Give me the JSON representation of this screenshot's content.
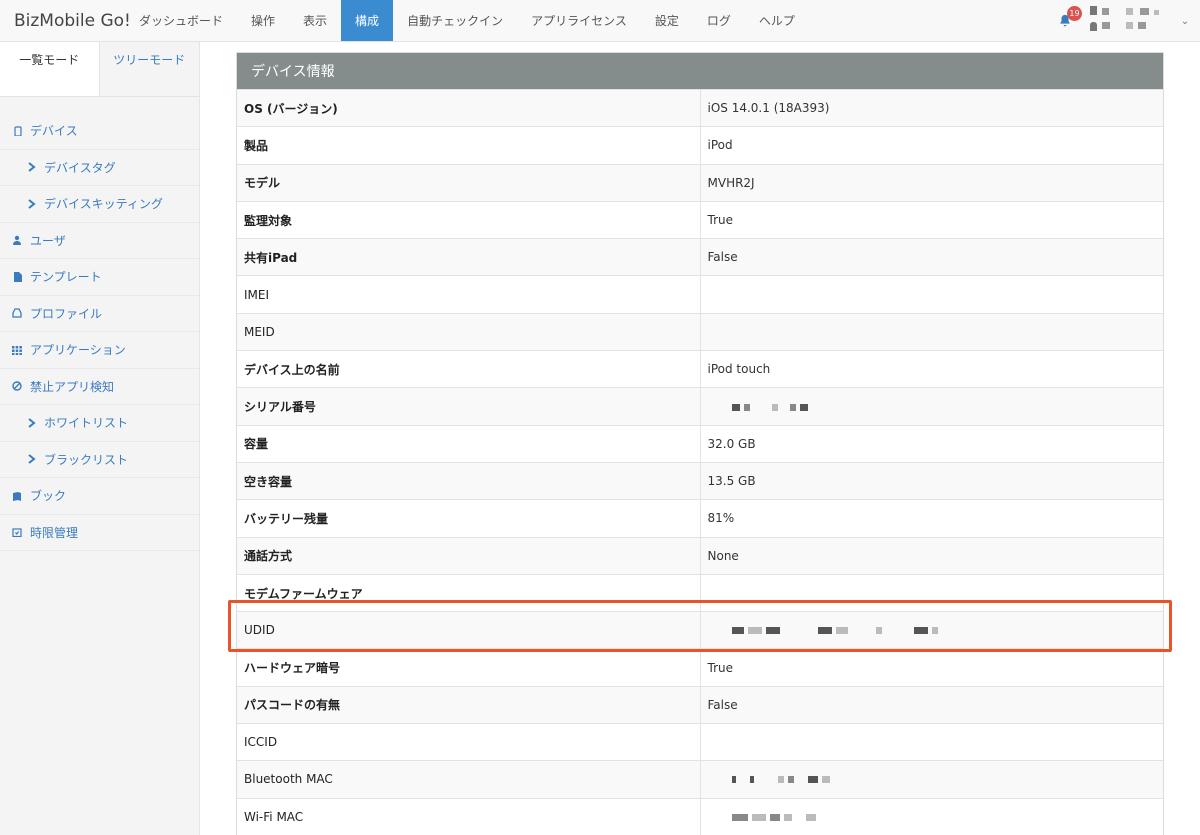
{
  "navbar": {
    "brand": "BizMobile Go!",
    "items": [
      {
        "label": "ダッシュボード",
        "active": false
      },
      {
        "label": "操作",
        "active": false
      },
      {
        "label": "表示",
        "active": false
      },
      {
        "label": "構成",
        "active": true
      },
      {
        "label": "自動チェックイン",
        "active": false
      },
      {
        "label": "アプリライセンス",
        "active": false
      },
      {
        "label": "設定",
        "active": false
      },
      {
        "label": "ログ",
        "active": false
      },
      {
        "label": "ヘルプ",
        "active": false
      }
    ],
    "notification_count": "19",
    "icons": {
      "bell": "bell-icon",
      "caret": "chevron-down-icon"
    }
  },
  "sidebar": {
    "mode_tabs": [
      {
        "label": "一覧モード",
        "active": true
      },
      {
        "label": "ツリーモード",
        "active": false
      }
    ],
    "items": [
      {
        "label": "デバイス",
        "icon": "device-icon",
        "sub": false
      },
      {
        "label": "デバイスタグ",
        "icon": "chevron-right-icon",
        "sub": true
      },
      {
        "label": "デバイスキッティング",
        "icon": "chevron-right-icon",
        "sub": true
      },
      {
        "label": "ユーザ",
        "icon": "user-icon",
        "sub": false
      },
      {
        "label": "テンプレート",
        "icon": "file-icon",
        "sub": false
      },
      {
        "label": "プロファイル",
        "icon": "inbox-icon",
        "sub": false
      },
      {
        "label": "アプリケーション",
        "icon": "grid-icon",
        "sub": false
      },
      {
        "label": "禁止アプリ検知",
        "icon": "ban-icon",
        "sub": false
      },
      {
        "label": "ホワイトリスト",
        "icon": "chevron-right-icon",
        "sub": true
      },
      {
        "label": "ブラックリスト",
        "icon": "chevron-right-icon",
        "sub": true
      },
      {
        "label": "ブック",
        "icon": "book-icon",
        "sub": false
      },
      {
        "label": "時限管理",
        "icon": "calendar-icon",
        "sub": false
      }
    ]
  },
  "panel": {
    "title": "デバイス情報",
    "rows": [
      {
        "key": "OS (バージョン)",
        "value": "iOS 14.0.1 (18A393)",
        "bold": true
      },
      {
        "key": "製品",
        "value": "iPod",
        "bold": true
      },
      {
        "key": "モデル",
        "value": "MVHR2J",
        "bold": true
      },
      {
        "key": "監理対象",
        "value": "True",
        "bold": true
      },
      {
        "key": "共有iPad",
        "value": "False",
        "bold": true
      },
      {
        "key": "IMEI",
        "value": "",
        "bold": false
      },
      {
        "key": "MEID",
        "value": "",
        "bold": false
      },
      {
        "key": "デバイス上の名前",
        "value": "iPod touch",
        "bold": true
      },
      {
        "key": "シリアル番号",
        "value": "",
        "bold": true,
        "redacted": true
      },
      {
        "key": "容量",
        "value": "32.0 GB",
        "bold": true
      },
      {
        "key": "空き容量",
        "value": "13.5 GB",
        "bold": true
      },
      {
        "key": "バッテリー残量",
        "value": "81%",
        "bold": true
      },
      {
        "key": "通話方式",
        "value": "None",
        "bold": true
      },
      {
        "key": "モデムファームウェア",
        "value": "",
        "bold": true
      },
      {
        "key": "UDID",
        "value": "",
        "bold": false,
        "redacted": true,
        "highlighted": true
      },
      {
        "key": "ハードウェア暗号",
        "value": "True",
        "bold": true
      },
      {
        "key": "パスコードの有無",
        "value": "False",
        "bold": true
      },
      {
        "key": "ICCID",
        "value": "",
        "bold": false
      },
      {
        "key": "Bluetooth MAC",
        "value": "",
        "bold": false,
        "redacted": true
      },
      {
        "key": "Wi-Fi MAC",
        "value": "",
        "bold": false,
        "redacted": true
      }
    ],
    "highlight_color": "#e8542a"
  }
}
